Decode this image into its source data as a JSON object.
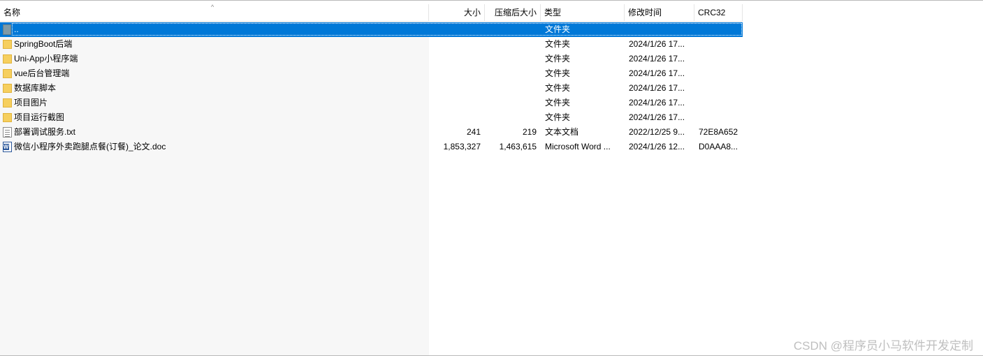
{
  "columns": {
    "name": "名称",
    "size": "大小",
    "compressed": "压缩后大小",
    "type": "类型",
    "modified": "修改时间",
    "crc": "CRC32"
  },
  "sort_indicator": "^",
  "rows": [
    {
      "name": "..",
      "size": "",
      "compressed": "",
      "type": "文件夹",
      "modified": "",
      "crc": "",
      "icon": "parent-folder-icon",
      "selected": true
    },
    {
      "name": "SpringBoot后端",
      "size": "",
      "compressed": "",
      "type": "文件夹",
      "modified": "2024/1/26 17...",
      "crc": "",
      "icon": "folder-icon"
    },
    {
      "name": "Uni-App小程序端",
      "size": "",
      "compressed": "",
      "type": "文件夹",
      "modified": "2024/1/26 17...",
      "crc": "",
      "icon": "folder-icon"
    },
    {
      "name": "vue后台管理端",
      "size": "",
      "compressed": "",
      "type": "文件夹",
      "modified": "2024/1/26 17...",
      "crc": "",
      "icon": "folder-icon"
    },
    {
      "name": "数据库脚本",
      "size": "",
      "compressed": "",
      "type": "文件夹",
      "modified": "2024/1/26 17...",
      "crc": "",
      "icon": "folder-icon"
    },
    {
      "name": "项目图片",
      "size": "",
      "compressed": "",
      "type": "文件夹",
      "modified": "2024/1/26 17...",
      "crc": "",
      "icon": "folder-icon"
    },
    {
      "name": "项目运行截图",
      "size": "",
      "compressed": "",
      "type": "文件夹",
      "modified": "2024/1/26 17...",
      "crc": "",
      "icon": "folder-icon"
    },
    {
      "name": "部署调试服务.txt",
      "size": "241",
      "compressed": "219",
      "type": "文本文档",
      "modified": "2022/12/25 9...",
      "crc": "72E8A652",
      "icon": "text-file-icon"
    },
    {
      "name": "微信小程序外卖跑腿点餐(订餐)_论文.doc",
      "size": "1,853,327",
      "compressed": "1,463,615",
      "type": "Microsoft Word ...",
      "modified": "2024/1/26 12...",
      "crc": "D0AAA8...",
      "icon": "word-document-icon"
    }
  ],
  "watermark": "CSDN @程序员小马软件开发定制",
  "colors": {
    "selection": "#0078d7",
    "folder": "#f6cf5e",
    "name_column_bg": "#f7f7f7"
  }
}
